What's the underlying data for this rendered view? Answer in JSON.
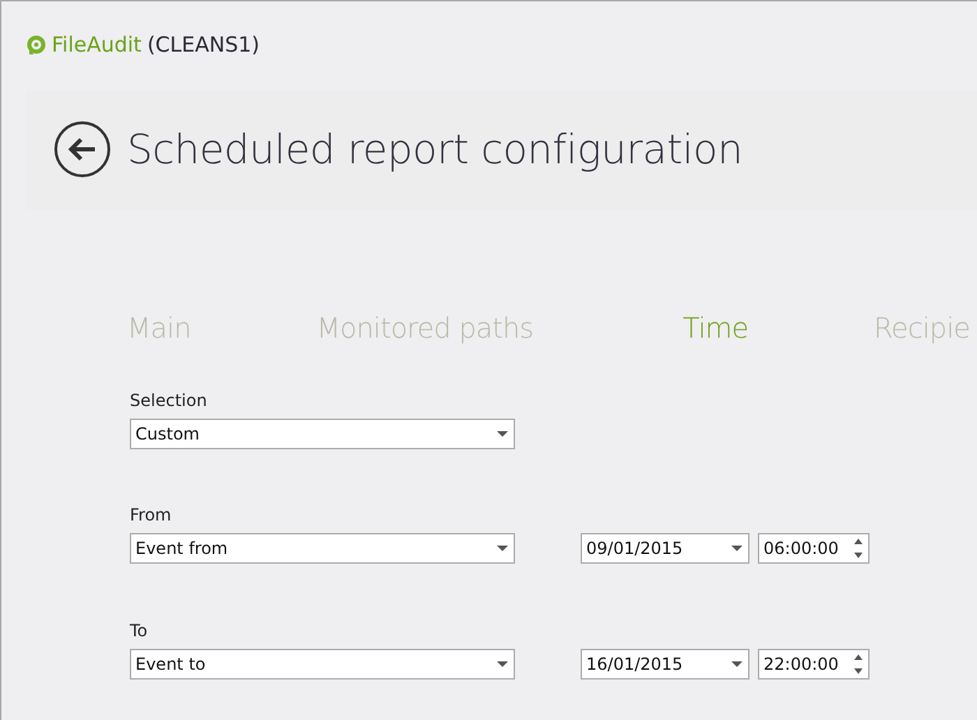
{
  "app": {
    "name": "FileAudit",
    "server": "(CLEANS1)"
  },
  "page": {
    "title": "Scheduled report configuration"
  },
  "tabs": [
    {
      "label": "Main",
      "selected": false
    },
    {
      "label": "Monitored paths",
      "selected": false
    },
    {
      "label": "Time",
      "selected": true
    },
    {
      "label": "Recipie",
      "selected": false
    }
  ],
  "selection": {
    "label": "Selection",
    "value": "Custom"
  },
  "ranges": [
    {
      "label": "From",
      "event": "Event from",
      "date": "09/01/2015",
      "time": "06:00:00"
    },
    {
      "label": "To",
      "event": "Event to",
      "date": "16/01/2015",
      "time": "22:00:00"
    }
  ]
}
